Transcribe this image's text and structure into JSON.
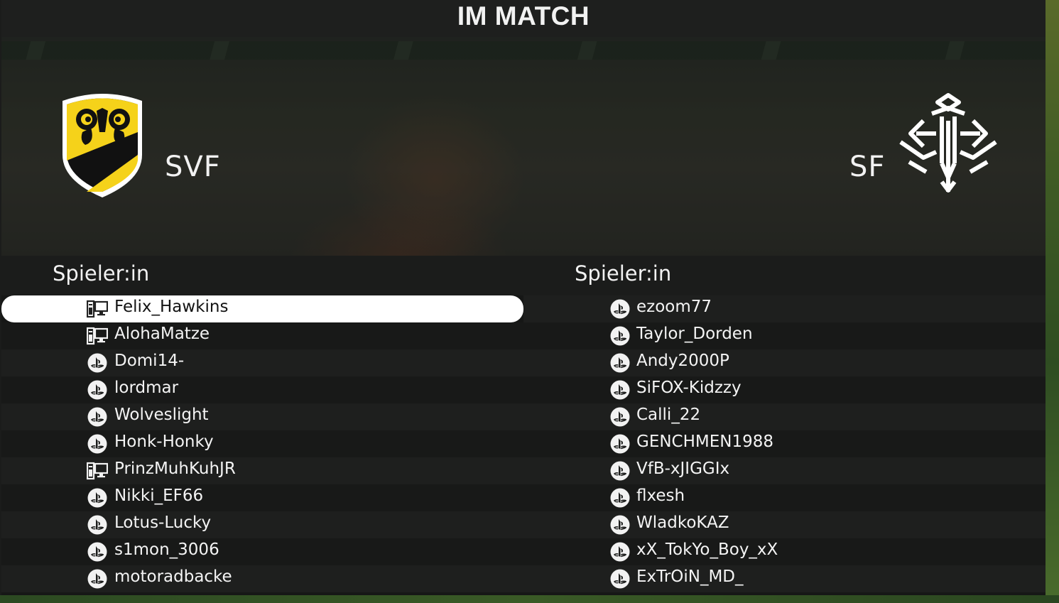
{
  "header": {
    "title": "IM MATCH"
  },
  "teams": {
    "home": {
      "abbr": "SVF",
      "crest_icon": "svf-ram-crest",
      "colors": [
        "#f5d21a",
        "#111111"
      ]
    },
    "away": {
      "abbr": "SF",
      "crest_icon": "sf-white-emblem"
    }
  },
  "lists": {
    "home": {
      "header": "Spieler:in",
      "players": [
        {
          "name": "Felix_Hawkins",
          "platform": "pc",
          "selected": true
        },
        {
          "name": "AlohaMatze",
          "platform": "pc"
        },
        {
          "name": "Domi14-",
          "platform": "playstation"
        },
        {
          "name": "lordmar",
          "platform": "playstation"
        },
        {
          "name": "Wolveslight",
          "platform": "playstation"
        },
        {
          "name": "Honk-Honky",
          "platform": "playstation"
        },
        {
          "name": "PrinzMuhKuhJR",
          "platform": "pc"
        },
        {
          "name": "Nikki_EF66",
          "platform": "playstation"
        },
        {
          "name": "Lotus-Lucky",
          "platform": "playstation"
        },
        {
          "name": "s1mon_3006",
          "platform": "playstation"
        },
        {
          "name": "motoradbacke",
          "platform": "playstation"
        }
      ]
    },
    "away": {
      "header": "Spieler:in",
      "players": [
        {
          "name": "ezoom77",
          "platform": "playstation"
        },
        {
          "name": "Taylor_Dorden",
          "platform": "playstation"
        },
        {
          "name": "Andy2000P",
          "platform": "playstation"
        },
        {
          "name": "SiFOX-Kidzzy",
          "platform": "playstation"
        },
        {
          "name": "Calli_22",
          "platform": "playstation"
        },
        {
          "name": "GENCHMEN1988",
          "platform": "playstation"
        },
        {
          "name": "VfB-xJIGGIx",
          "platform": "playstation"
        },
        {
          "name": "flxesh",
          "platform": "playstation"
        },
        {
          "name": "WladkoKAZ",
          "platform": "playstation"
        },
        {
          "name": "xX_TokYo_Boy_xX",
          "platform": "playstation"
        },
        {
          "name": "ExTrOiN_MD_",
          "platform": "playstation"
        }
      ]
    }
  },
  "icons": {
    "pc": "pc-platform-icon",
    "playstation": "playstation-icon"
  }
}
